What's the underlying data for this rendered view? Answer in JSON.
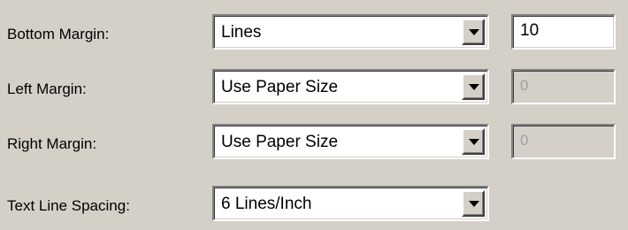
{
  "colors": {
    "dialog_background": "#d4d0c8",
    "field_background": "#ffffff",
    "disabled_text": "#a0a0a0"
  },
  "rows": [
    {
      "label": "Bottom Margin:",
      "dropdown": {
        "value": "Lines",
        "icon": "chevron-down-icon"
      },
      "field": {
        "value": "10",
        "enabled": true
      }
    },
    {
      "label": "Left Margin:",
      "dropdown": {
        "value": "Use Paper Size",
        "icon": "chevron-down-icon"
      },
      "field": {
        "value": "0",
        "enabled": false
      }
    },
    {
      "label": "Right Margin:",
      "dropdown": {
        "value": "Use Paper Size",
        "icon": "chevron-down-icon"
      },
      "field": {
        "value": "0",
        "enabled": false
      }
    },
    {
      "label": "Text Line Spacing:",
      "dropdown": {
        "value": "6 Lines/Inch",
        "icon": "chevron-down-icon"
      }
    }
  ]
}
